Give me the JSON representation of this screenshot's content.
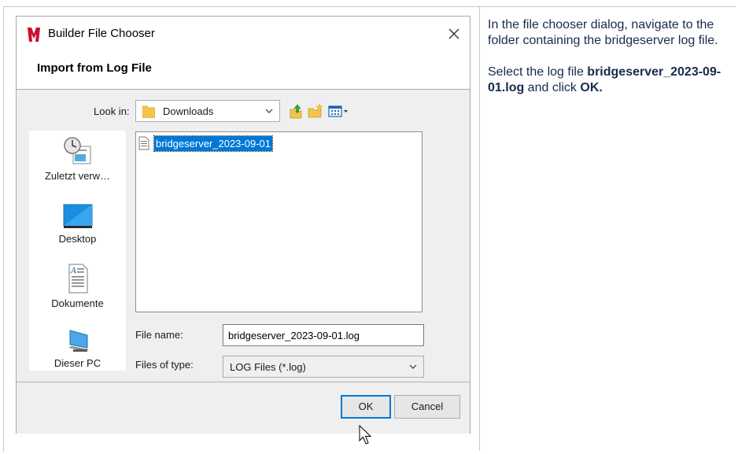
{
  "dialog": {
    "title": "Builder File Chooser",
    "heading": "Import from Log File",
    "look_in_label": "Look in:",
    "look_in_value": "Downloads",
    "places": [
      {
        "label": "Zuletzt verw…",
        "icon": "recent-icon"
      },
      {
        "label": "Desktop",
        "icon": "desktop-icon"
      },
      {
        "label": "Dokumente",
        "icon": "documents-icon"
      },
      {
        "label": "Dieser PC",
        "icon": "computer-icon"
      }
    ],
    "files": [
      {
        "name": "bridgeserver_2023-09-01",
        "selected": true
      }
    ],
    "file_name_label": "File name:",
    "file_name_value": "bridgeserver_2023-09-01.log",
    "files_of_type_label": "Files of type:",
    "files_of_type_value": "LOG Files (*.log)",
    "ok_label": "OK",
    "cancel_label": "Cancel"
  },
  "instructions": {
    "para1": "In the file chooser dialog, navigate to the folder containing the bridgeserver log file.",
    "para2_prefix": "Select the log file ",
    "para2_file": "bridgeserver_2023-09-01.log",
    "para2_mid": " and click ",
    "para2_ok": "OK."
  },
  "colors": {
    "selection": "#0078d7",
    "logo": "#c8102e",
    "folder": "#f4c54a"
  }
}
